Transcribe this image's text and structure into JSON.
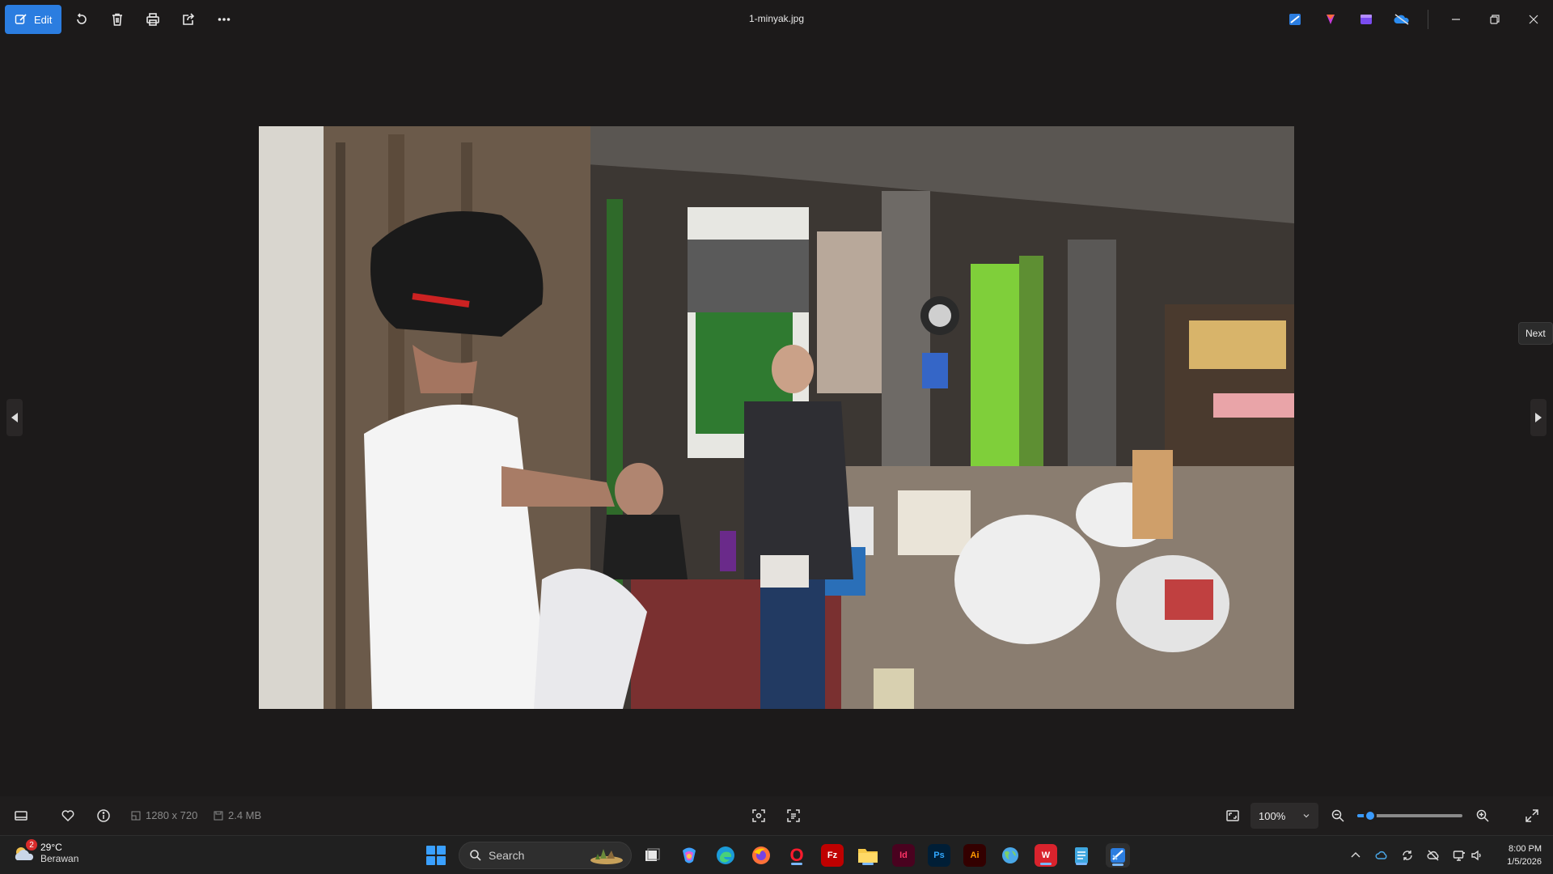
{
  "window": {
    "title": "1-minyak.jpg",
    "edit_label": "Edit",
    "next_tooltip": "Next"
  },
  "bottombar": {
    "dimensions": "1280 x 720",
    "file_size": "2.4 MB",
    "zoom": "100%",
    "zoom_level": 0.12
  },
  "taskbar": {
    "weather_temp": "29°C",
    "weather_desc": "Berawan",
    "weather_badge": "2",
    "search_placeholder": "Search",
    "time": "8:00 PM",
    "date": "1/5/2026",
    "apps": [
      {
        "name": "task-view-icon",
        "label": ""
      },
      {
        "name": "copilot-icon",
        "label": ""
      },
      {
        "name": "edge-icon",
        "label": ""
      },
      {
        "name": "firefox-icon",
        "label": ""
      },
      {
        "name": "opera-icon",
        "label": "O"
      },
      {
        "name": "filezilla-icon",
        "label": "Fz"
      },
      {
        "name": "file-explorer-icon",
        "label": ""
      },
      {
        "name": "indesign-icon",
        "label": "Id"
      },
      {
        "name": "photoshop-icon",
        "label": "Ps"
      },
      {
        "name": "illustrator-icon",
        "label": "Ai"
      },
      {
        "name": "globe-app-icon",
        "label": ""
      },
      {
        "name": "wps-icon",
        "label": "W"
      },
      {
        "name": "notepad-icon",
        "label": ""
      },
      {
        "name": "photos-icon",
        "label": ""
      }
    ]
  }
}
